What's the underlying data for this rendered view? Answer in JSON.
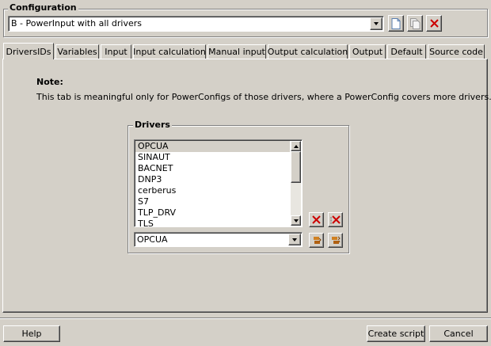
{
  "configuration": {
    "legend": "Configuration",
    "selected": "B - PowerInput with all drivers",
    "new_icon": "new-document-icon",
    "copy_icon": "copy-document-icon",
    "delete_icon": "delete-x-icon"
  },
  "tabs": [
    {
      "label": "DriversIDs",
      "active": true
    },
    {
      "label": "Variables"
    },
    {
      "label": "Input"
    },
    {
      "label": "Input calculation"
    },
    {
      "label": "Manual input"
    },
    {
      "label": "Output calculation"
    },
    {
      "label": "Output"
    },
    {
      "label": "Default"
    },
    {
      "label": "Source code"
    }
  ],
  "note": {
    "title": "Note:",
    "text": "This tab is meaningful only for PowerConfigs of those drivers, where a PowerConfig covers more drivers."
  },
  "drivers": {
    "legend": "Drivers",
    "items": [
      "OPCUA",
      "SINAUT",
      "BACNET",
      "DNP3",
      "cerberus",
      "S7",
      "TLP_DRV",
      "TLS"
    ],
    "selected_item": "OPCUA",
    "combo_value": "OPCUA"
  },
  "footer": {
    "help_label": "Help",
    "create_label": "Create script",
    "cancel_label": "Cancel"
  },
  "colors": {
    "background": "#d4d0c8",
    "delete_red": "#cc0000",
    "add_orange": "#d08020"
  }
}
